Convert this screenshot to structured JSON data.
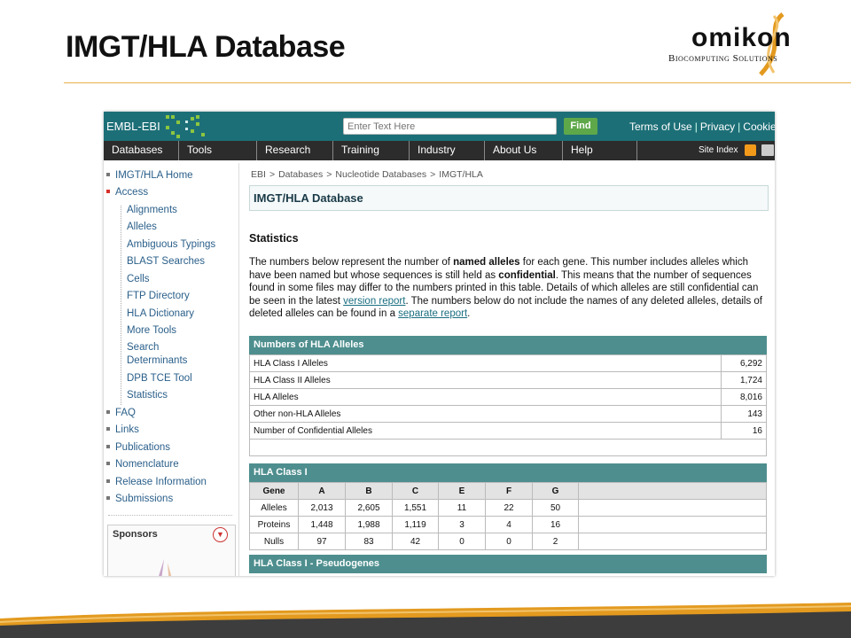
{
  "slide": {
    "title": "IMGT/HLA Database",
    "logo_word": "omikon",
    "logo_sub": "Biocomputing Solutions"
  },
  "browser": {
    "brand": "EMBL-EBI",
    "search_placeholder": "Enter Text Here",
    "find_label": "Find",
    "top_links": [
      "Terms of Use",
      "Privacy",
      "Cookie"
    ],
    "nav": [
      "Databases",
      "Tools",
      "Research",
      "Training",
      "Industry",
      "About Us",
      "Help"
    ],
    "site_index": "Site Index",
    "colors": {
      "topbar": "#1d6f77",
      "nav": "#2c2c2c",
      "find": "#5ea84a",
      "section": "#4e8e8e"
    }
  },
  "sidebar": {
    "top_items": [
      "IMGT/HLA Home",
      "Access"
    ],
    "sub_items": [
      "Alignments",
      "Alleles",
      "Ambiguous Typings",
      "BLAST Searches",
      "Cells",
      "FTP Directory",
      "HLA Dictionary",
      "More Tools",
      "Search",
      "Determinants",
      "DPB TCE Tool",
      "Statistics"
    ],
    "bottom_items": [
      "FAQ",
      "Links",
      "Publications",
      "Nomenclature",
      "Release Information",
      "Submissions"
    ],
    "sponsors_title": "Sponsors"
  },
  "main": {
    "breadcrumb": [
      "EBI",
      "Databases",
      "Nucleotide Databases",
      "IMGT/HLA"
    ],
    "db_title": "IMGT/HLA Database",
    "stats_heading": "Statistics",
    "paragraph": {
      "p1": "The numbers below represent the number of ",
      "b1": "named alleles",
      "p2": " for each gene. This number includes alleles which have been named but whose sequences is still held as ",
      "b2": "confidential",
      "p3": ". This means that the number of sequences found in some files may differ to the numbers printed in this table. Details of which alleles are still confidential can be seen in the latest ",
      "link1": "version report",
      "p4": ". The numbers below do not include the names of any deleted alleles, details of deleted alleles can be found in a ",
      "link2": "separate report",
      "p5": "."
    },
    "numbers_table": {
      "title": "Numbers of HLA Alleles",
      "rows": [
        {
          "label": "HLA Class I Alleles",
          "value": "6,292"
        },
        {
          "label": "HLA Class II Alleles",
          "value": "1,724"
        },
        {
          "label": "HLA Alleles",
          "value": "8,016"
        },
        {
          "label": "Other non-HLA Alleles",
          "value": "143"
        },
        {
          "label": "Number of Confidential Alleles",
          "value": "16"
        }
      ]
    },
    "class1_table": {
      "title": "HLA Class I",
      "headers": [
        "Gene",
        "A",
        "B",
        "C",
        "E",
        "F",
        "G"
      ],
      "rows": [
        {
          "label": "Alleles",
          "values": [
            "2,013",
            "2,605",
            "1,551",
            "11",
            "22",
            "50"
          ]
        },
        {
          "label": "Proteins",
          "values": [
            "1,448",
            "1,988",
            "1,119",
            "3",
            "4",
            "16"
          ]
        },
        {
          "label": "Nulls",
          "values": [
            "97",
            "83",
            "42",
            "0",
            "0",
            "2"
          ]
        }
      ]
    },
    "pseudogenes_title": "HLA Class I - Pseudogenes"
  }
}
